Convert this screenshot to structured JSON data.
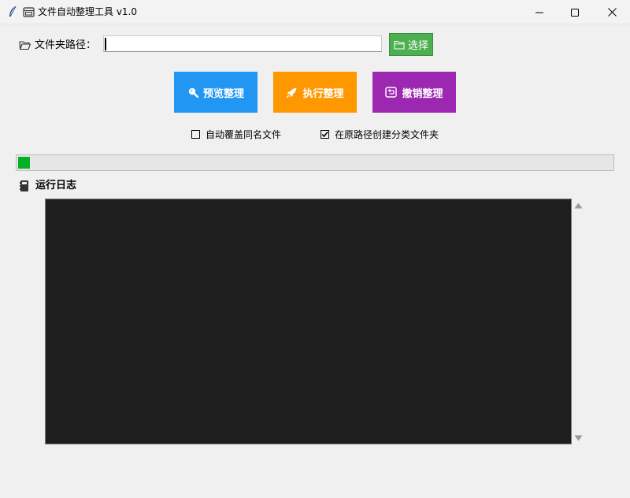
{
  "window": {
    "title": "文件自动整理工具 v1.0",
    "app_icon": "feather-icon",
    "title_icon": "folder-window-icon",
    "controls": [
      "minimize-icon",
      "maximize-icon",
      "close-icon"
    ]
  },
  "folder": {
    "label": "文件夹路径：",
    "icon": "open-folder-icon",
    "input_value": "",
    "select_label": "选择",
    "select_icon": "folder-icon"
  },
  "actions": {
    "preview_label": "预览整理",
    "preview_icon": "magnifier-icon",
    "execute_label": "执行整理",
    "execute_icon": "rocket-icon",
    "undo_label": "撤销整理",
    "undo_icon": "undo-icon"
  },
  "options": {
    "overwrite_label": "自动覆盖同名文件",
    "overwrite_checked": false,
    "create_folder_label": "在原路径创建分类文件夹",
    "create_folder_checked": true
  },
  "progress": {
    "fraction": 0.02
  },
  "log": {
    "title": "运行日志",
    "icon": "log-book-icon",
    "content": ""
  },
  "colors": {
    "select_button": "#4caf50",
    "preview_button": "#2196f3",
    "execute_button": "#ff9800",
    "undo_button": "#9c27b0",
    "progress_fill": "#06b025",
    "log_background": "#1e1e1e"
  }
}
